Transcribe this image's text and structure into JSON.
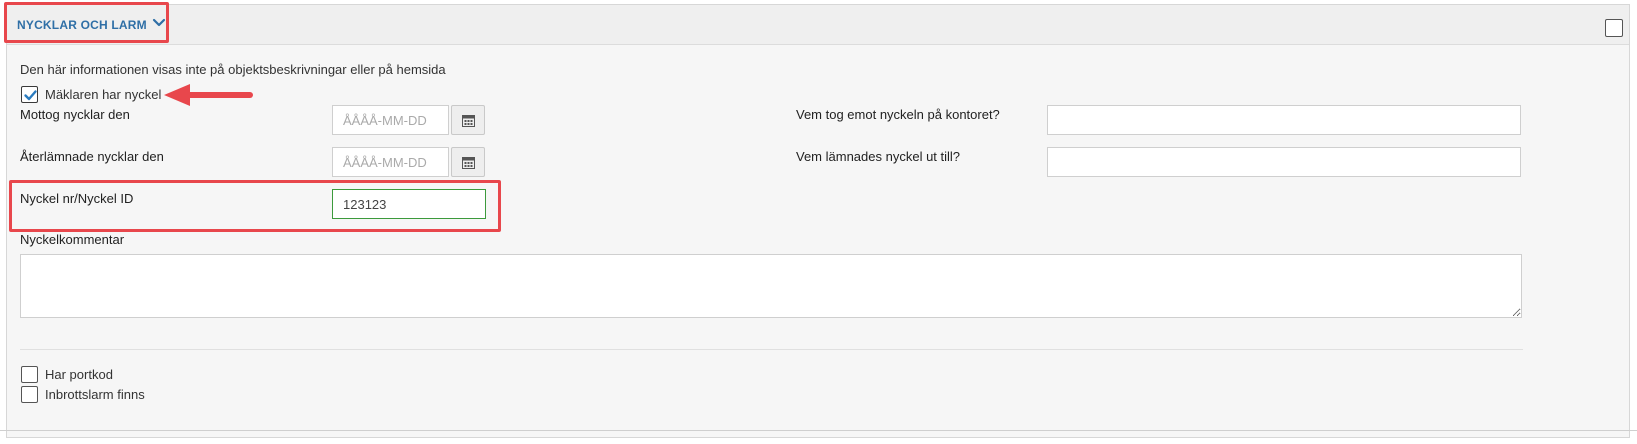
{
  "section": {
    "title": "NYCKLAR OCH LARM",
    "info_text": "Den här informationen visas inte på objektsbeskrivningar eller på hemsida"
  },
  "fields": {
    "broker_has_key": {
      "label": "Mäklaren har nyckel",
      "checked": true
    },
    "keys_received": {
      "label": "Mottog nycklar den",
      "placeholder": "ÅÅÅÅ-MM-DD",
      "value": ""
    },
    "keys_returned": {
      "label": "Återlämnade nycklar den",
      "placeholder": "ÅÅÅÅ-MM-DD",
      "value": ""
    },
    "who_received": {
      "label": "Vem tog emot nyckeln på kontoret?",
      "value": ""
    },
    "handed_to": {
      "label": "Vem lämnades nyckel ut till?",
      "value": ""
    },
    "key_id": {
      "label": "Nyckel nr/Nyckel ID",
      "value": "123123"
    },
    "key_comment": {
      "label": "Nyckelkommentar",
      "value": ""
    },
    "has_door_code": {
      "label": "Har portkod",
      "checked": false
    },
    "burglar_alarm": {
      "label": "Inbrottslarm finns",
      "checked": false
    }
  },
  "icons": {
    "chevron": "chevron-down-icon",
    "calendar": "calendar-icon",
    "check": "check-icon",
    "arrow": "arrow-left-icon"
  },
  "colors": {
    "accent": "#2f6fa6",
    "highlight": "#e8474c",
    "valid_border": "#3c9a3c"
  }
}
